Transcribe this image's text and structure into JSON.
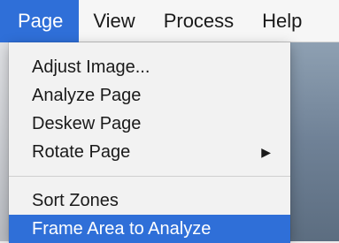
{
  "menubar": {
    "items": [
      {
        "label": "Page",
        "active": true
      },
      {
        "label": "View",
        "active": false
      },
      {
        "label": "Process",
        "active": false
      },
      {
        "label": "Help",
        "active": false
      }
    ]
  },
  "page_menu": {
    "items": [
      {
        "label": "Adjust Image..."
      },
      {
        "label": "Analyze Page"
      },
      {
        "label": "Deskew Page"
      },
      {
        "label": "Rotate Page",
        "has_submenu": true,
        "submenu_icon": "triangle-right-icon"
      },
      {
        "label": "Sort Zones"
      },
      {
        "label": "Frame Area to Analyze",
        "highlighted": true
      }
    ]
  },
  "colors": {
    "highlight": "#2f6fd8",
    "menu_background": "#f2f2f2",
    "menubar_background": "#f6f6f6"
  }
}
